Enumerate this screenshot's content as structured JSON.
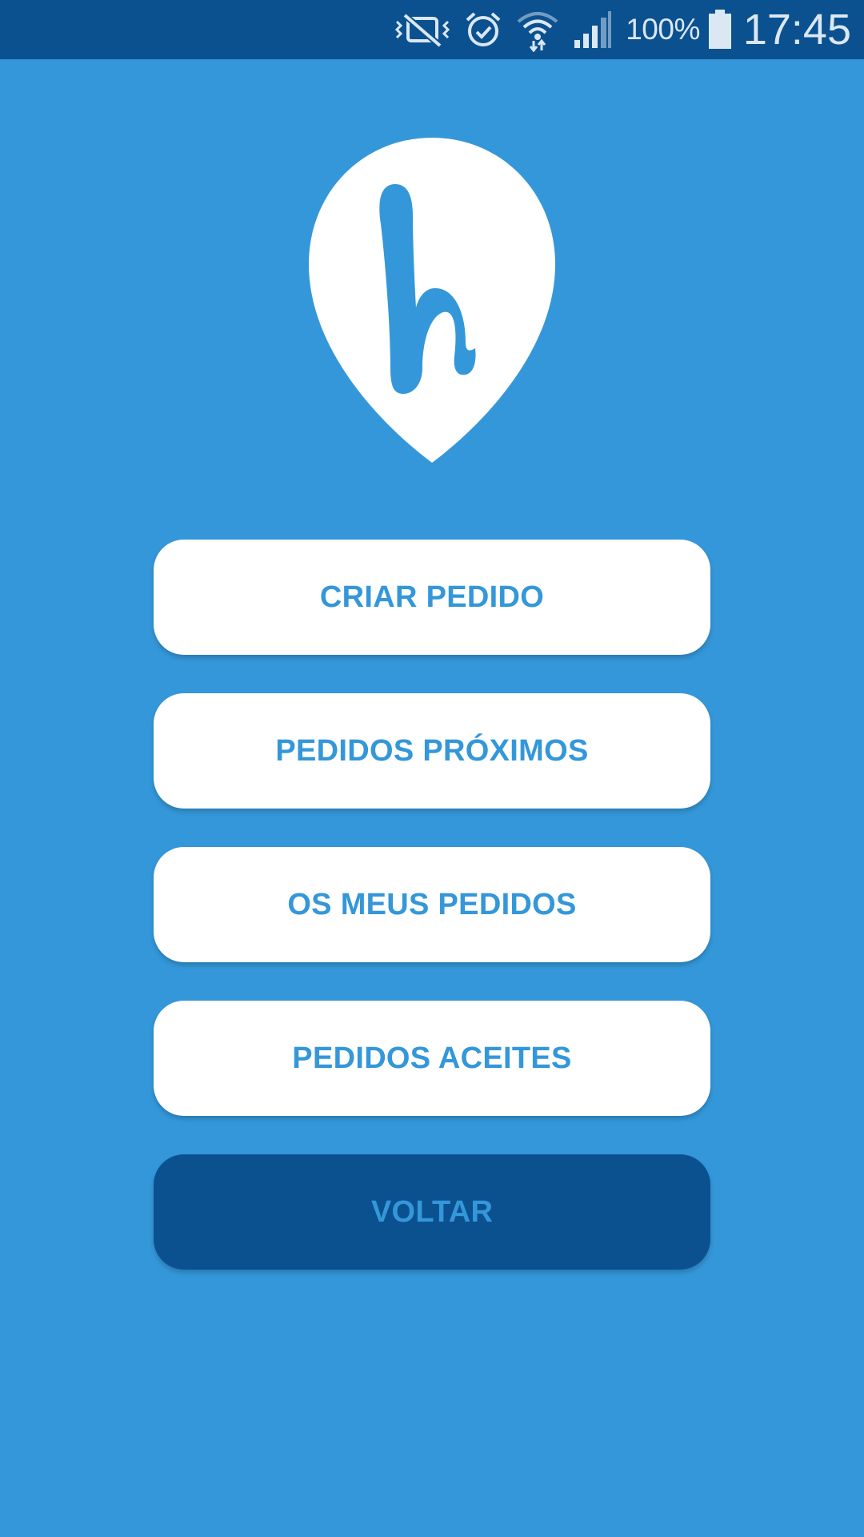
{
  "status_bar": {
    "battery_percent": "100%",
    "time": "17:45",
    "icons": [
      "vibrate-mute-icon",
      "alarm-icon",
      "wifi-icon",
      "signal-icon",
      "battery-icon"
    ]
  },
  "logo": {
    "icon": "map-pin-logo",
    "letter": "h"
  },
  "menu": {
    "create_request": "CRIAR PEDIDO",
    "nearby_requests": "PEDIDOS PRÓXIMOS",
    "my_requests": "OS MEUS PEDIDOS",
    "accepted_requests": "PEDIDOS ACEITES",
    "back": "VOLTAR"
  },
  "colors": {
    "background": "#3497d9",
    "status_bar": "#0b5190",
    "button": "#ffffff",
    "button_text": "#3497d9",
    "back_button": "#0b5190"
  }
}
